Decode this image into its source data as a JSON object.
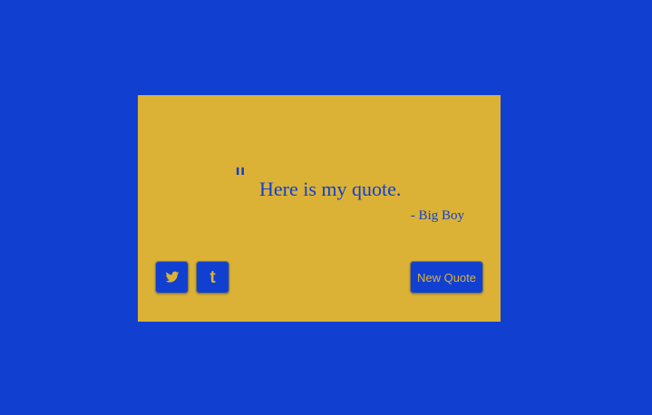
{
  "quote": {
    "mark": "\"",
    "text": "Here is my quote.",
    "author": "- Big Boy"
  },
  "actions": {
    "twitter_icon": "twitter-icon",
    "tumblr_icon": "tumblr-icon",
    "tumblr_glyph": "t",
    "new_quote_label": "New Quote"
  },
  "colors": {
    "background": "#1140d1",
    "card": "#dbb236",
    "accent_text": "#1140d1",
    "button_text": "#dbb236"
  }
}
